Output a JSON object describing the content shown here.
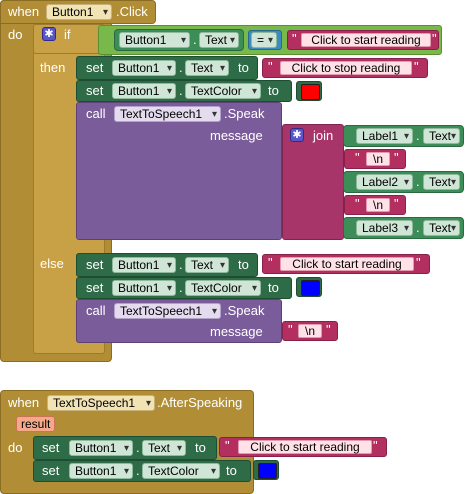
{
  "event1": {
    "when": "when",
    "component": "Button1",
    "event": ".Click",
    "do": "do",
    "if_label": "if",
    "then_label": "then",
    "else_label": "else",
    "cond_component": "Button1",
    "cond_property": "Text",
    "cond_op": "=",
    "cond_value": "Click to start reading",
    "then_set1": {
      "set": "set",
      "component": "Button1",
      "property": "Text",
      "to": "to",
      "value": "Click to stop reading"
    },
    "then_set2": {
      "set": "set",
      "component": "Button1",
      "property": "TextColor",
      "to": "to",
      "color": "#ff0000"
    },
    "then_call": {
      "call": "call",
      "component": "TextToSpeech1",
      "method": ".Speak",
      "param": "message"
    },
    "join": {
      "label": "join",
      "items": [
        "Label1",
        "Text",
        "\\n",
        "Label2",
        "Text",
        "\\n",
        "Label3",
        "Text"
      ]
    },
    "else_set1": {
      "set": "set",
      "component": "Button1",
      "property": "Text",
      "to": "to",
      "value": "Click to start reading"
    },
    "else_set2": {
      "set": "set",
      "component": "Button1",
      "property": "TextColor",
      "to": "to",
      "color": "#0000ff"
    },
    "else_call": {
      "call": "call",
      "component": "TextToSpeech1",
      "method": ".Speak",
      "param": "message",
      "value": "\\n"
    }
  },
  "event2": {
    "when": "when",
    "component": "TextToSpeech1",
    "event": ".AfterSpeaking",
    "param": "result",
    "do": "do",
    "set1": {
      "set": "set",
      "component": "Button1",
      "property": "Text",
      "to": "to",
      "value": "Click to start reading"
    },
    "set2": {
      "set": "set",
      "component": "Button1",
      "property": "TextColor",
      "to": "to",
      "color": "#0000ff"
    }
  },
  "colors": {
    "event": "#b18e35",
    "control": "#c8a045",
    "setter": "#2e6b47",
    "call": "#7b5c9a",
    "text": "#b22f60"
  }
}
